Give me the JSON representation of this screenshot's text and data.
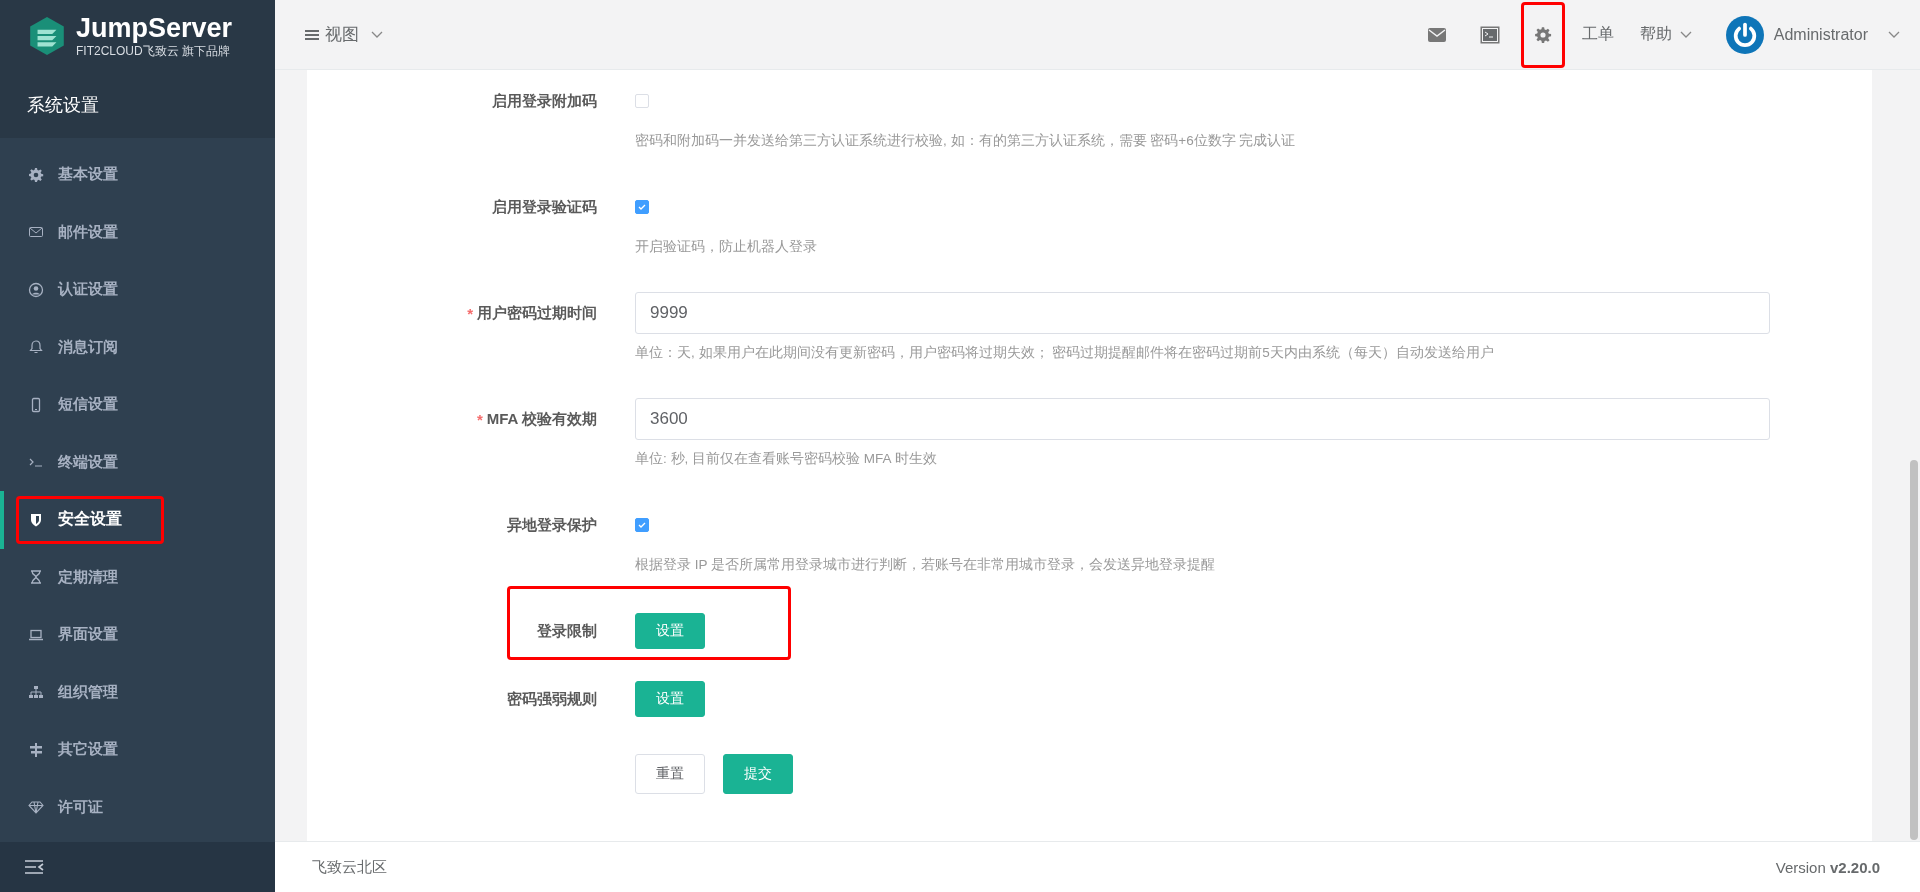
{
  "sidebar": {
    "logo": {
      "name": "JumpServer",
      "tagline": "FIT2CLOUD飞致云 旗下品牌"
    },
    "title": "系统设置",
    "items": [
      {
        "label": "基本设置",
        "selected": false,
        "highlighted": false
      },
      {
        "label": "邮件设置",
        "selected": false,
        "highlighted": false
      },
      {
        "label": "认证设置",
        "selected": false,
        "highlighted": false
      },
      {
        "label": "消息订阅",
        "selected": false,
        "highlighted": false
      },
      {
        "label": "短信设置",
        "selected": false,
        "highlighted": false
      },
      {
        "label": "终端设置",
        "selected": false,
        "highlighted": false
      },
      {
        "label": "安全设置",
        "selected": true,
        "highlighted": true
      },
      {
        "label": "定期清理",
        "selected": false,
        "highlighted": false
      },
      {
        "label": "界面设置",
        "selected": false,
        "highlighted": false
      },
      {
        "label": "组织管理",
        "selected": false,
        "highlighted": false
      },
      {
        "label": "其它设置",
        "selected": false,
        "highlighted": false
      },
      {
        "label": "许可证",
        "selected": false,
        "highlighted": false
      }
    ]
  },
  "topbar": {
    "view_menu": "视图",
    "actions": [
      {
        "kind": "icon",
        "highlighted": false
      },
      {
        "kind": "icon",
        "highlighted": false
      },
      {
        "kind": "icon",
        "highlighted": true
      },
      {
        "kind": "text",
        "label": "工单"
      },
      {
        "kind": "menu",
        "label": "帮助"
      }
    ],
    "user": "Administrator"
  },
  "form": {
    "fields": [
      {
        "kind": "checkbox",
        "label": "启用登录附加码",
        "checked": false,
        "help": "密码和附加码一并发送给第三方认证系统进行校验, 如：有的第三方认证系统，需要 密码+6位数字 完成认证"
      },
      {
        "kind": "checkbox",
        "label": "启用登录验证码",
        "checked": true,
        "help": "开启验证码，防止机器人登录"
      },
      {
        "kind": "input",
        "label": "用户密码过期时间",
        "required_mark": "*",
        "value": "9999",
        "help": "单位：天, 如果用户在此期间没有更新密码，用户密码将过期失效； 密码过期提醒邮件将在密码过期前5天内由系统（每天）自动发送给用户"
      },
      {
        "kind": "input",
        "label": "MFA 校验有效期",
        "required_mark": "*",
        "value": "3600",
        "help": "单位: 秒, 目前仅在查看账号密码校验 MFA 时生效"
      },
      {
        "kind": "checkbox",
        "label": "异地登录保护",
        "checked": true,
        "help": "根据登录 IP 是否所属常用登录城市进行判断，若账号在非常用城市登录，会发送异地登录提醒"
      },
      {
        "kind": "button",
        "label": "登录限制",
        "button": "设置",
        "highlighted": true
      },
      {
        "kind": "button",
        "label": "密码强弱规则",
        "button": "设置",
        "highlighted": false
      }
    ],
    "buttons": [
      {
        "label": "重置",
        "kind": "default"
      },
      {
        "label": "提交",
        "kind": "primary"
      }
    ]
  },
  "footer": {
    "left": "飞致云北区",
    "version": "Version **v2.20.0**"
  }
}
